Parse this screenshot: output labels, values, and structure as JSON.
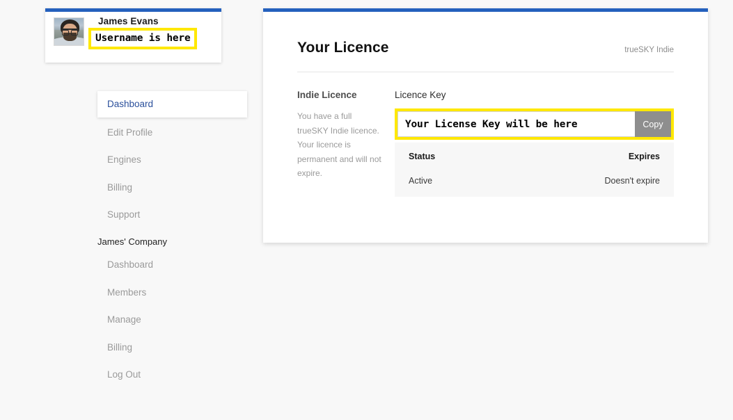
{
  "profile": {
    "name": "James Evans",
    "username_value": "Username is here",
    "avatar_alt": "user-avatar-photo"
  },
  "sidebar": {
    "primary_items": [
      {
        "label": "Dashboard",
        "active": true
      },
      {
        "label": "Edit Profile",
        "active": false
      },
      {
        "label": "Engines",
        "active": false
      },
      {
        "label": "Billing",
        "active": false
      },
      {
        "label": "Support",
        "active": false
      }
    ],
    "group_title": "James' Company",
    "secondary_items": [
      {
        "label": "Dashboard",
        "active": false
      },
      {
        "label": "Members",
        "active": false
      },
      {
        "label": "Manage",
        "active": false
      },
      {
        "label": "Billing",
        "active": false
      },
      {
        "label": "Log Out",
        "active": false
      }
    ]
  },
  "panel": {
    "title": "Your Licence",
    "product": "trueSKY Indie",
    "licence_heading": "Indie Licence",
    "licence_description": "You have a full trueSKY Indie licence. Your licence is permanent and will not expire.",
    "key_label": "Licence Key",
    "key_value": "Your License Key will be here",
    "copy_label": "Copy",
    "table": {
      "headers": [
        "Status",
        "Expires"
      ],
      "row": [
        "Active",
        "Doesn't expire"
      ]
    }
  },
  "colors": {
    "accent_blue": "#2460bd",
    "highlight_yellow": "#ffe800",
    "copy_button_gray": "#8e8e8e",
    "page_background": "#f8f8f8",
    "active_nav_text": "#2a4f9b"
  }
}
